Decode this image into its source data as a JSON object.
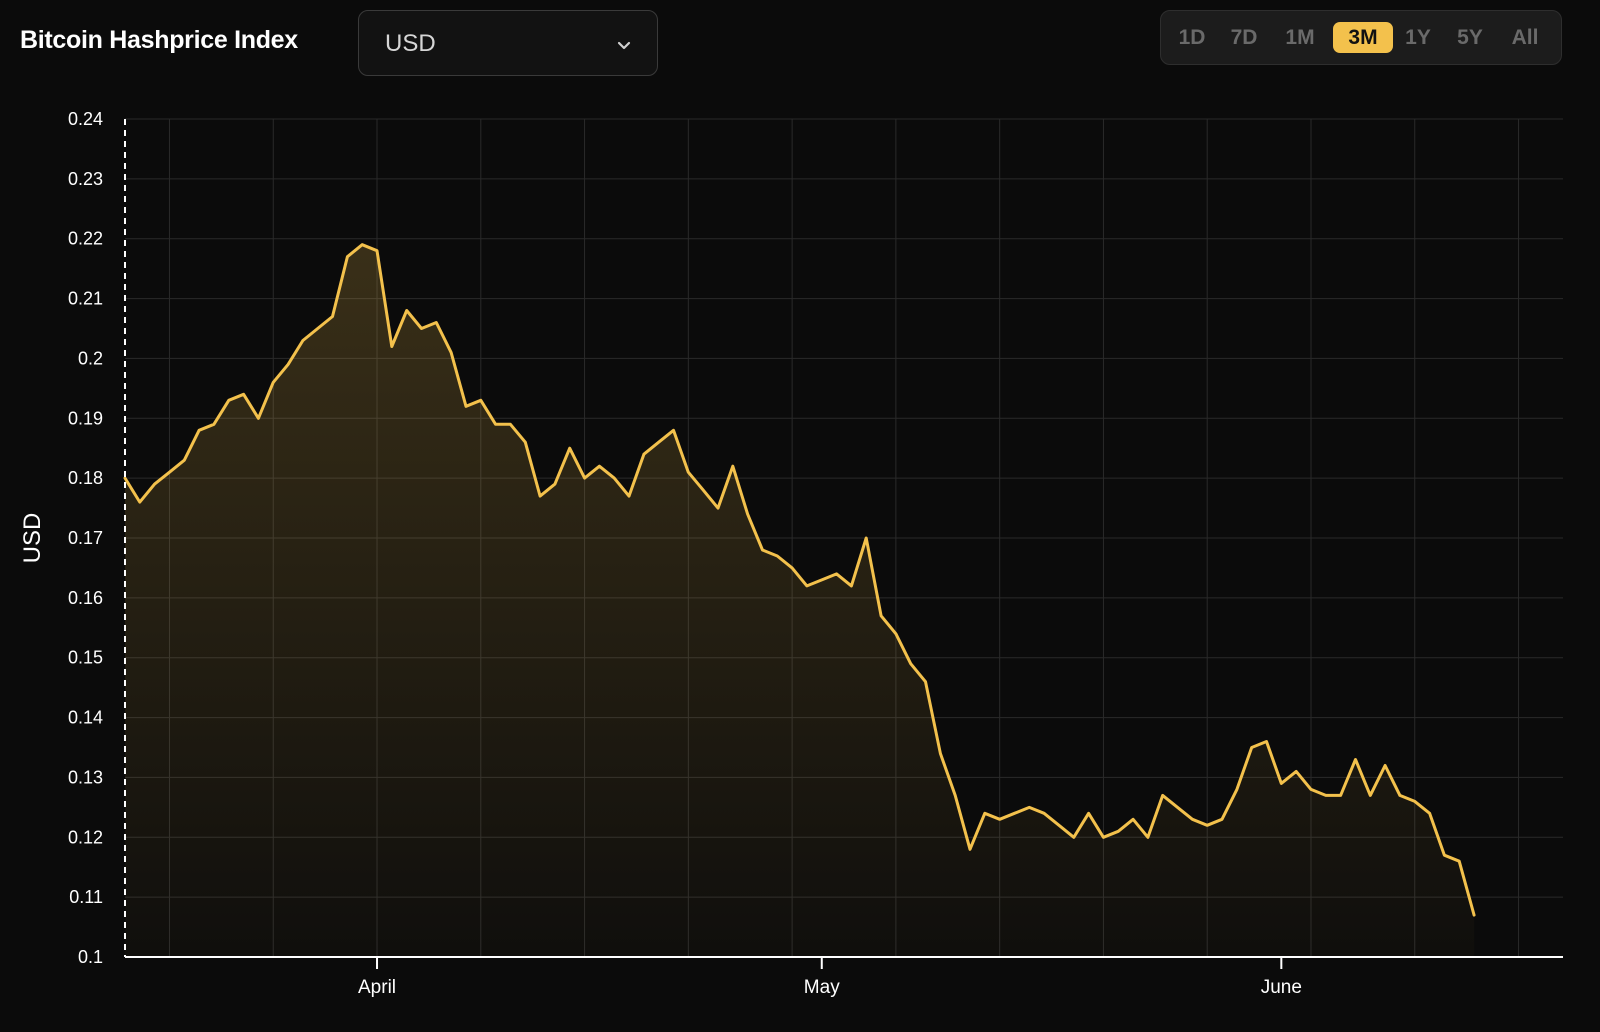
{
  "header": {
    "title": "Bitcoin Hashprice Index",
    "currency": "USD",
    "ranges": [
      "1D",
      "7D",
      "1M",
      "3M",
      "1Y",
      "5Y",
      "All"
    ],
    "active_range": "3M"
  },
  "colors": {
    "background": "#0b0b0b",
    "line": "#f3c14c",
    "grid": "#2a2a2a",
    "active_range_bg": "#f3c14c"
  },
  "chart_data": {
    "type": "area",
    "ylabel": "USD",
    "ylim": [
      0.1,
      0.24
    ],
    "yticks": [
      "0.24",
      "0.23",
      "0.22",
      "0.21",
      "0.2",
      "0.19",
      "0.18",
      "0.17",
      "0.16",
      "0.15",
      "0.14",
      "0.13",
      "0.12",
      "0.11",
      "0.1"
    ],
    "xlim": [
      "2024-03-15",
      "2024-06-20"
    ],
    "xticks": [
      {
        "label": "April",
        "date": "2024-04-01"
      },
      {
        "label": "May",
        "date": "2024-05-01"
      },
      {
        "label": "June",
        "date": "2024-06-01"
      }
    ],
    "grid": true,
    "series": [
      {
        "values": [
          [
            "2024-03-15",
            0.18
          ],
          [
            "2024-03-16",
            0.176
          ],
          [
            "2024-03-17",
            0.179
          ],
          [
            "2024-03-18",
            0.181
          ],
          [
            "2024-03-19",
            0.183
          ],
          [
            "2024-03-20",
            0.188
          ],
          [
            "2024-03-21",
            0.189
          ],
          [
            "2024-03-22",
            0.193
          ],
          [
            "2024-03-23",
            0.194
          ],
          [
            "2024-03-24",
            0.19
          ],
          [
            "2024-03-25",
            0.196
          ],
          [
            "2024-03-26",
            0.199
          ],
          [
            "2024-03-27",
            0.203
          ],
          [
            "2024-03-28",
            0.205
          ],
          [
            "2024-03-29",
            0.207
          ],
          [
            "2024-03-30",
            0.217
          ],
          [
            "2024-03-31",
            0.219
          ],
          [
            "2024-04-01",
            0.218
          ],
          [
            "2024-04-02",
            0.202
          ],
          [
            "2024-04-03",
            0.208
          ],
          [
            "2024-04-04",
            0.205
          ],
          [
            "2024-04-05",
            0.206
          ],
          [
            "2024-04-06",
            0.201
          ],
          [
            "2024-04-07",
            0.192
          ],
          [
            "2024-04-08",
            0.193
          ],
          [
            "2024-04-09",
            0.189
          ],
          [
            "2024-04-10",
            0.189
          ],
          [
            "2024-04-11",
            0.186
          ],
          [
            "2024-04-12",
            0.177
          ],
          [
            "2024-04-13",
            0.179
          ],
          [
            "2024-04-14",
            0.185
          ],
          [
            "2024-04-15",
            0.18
          ],
          [
            "2024-04-16",
            0.182
          ],
          [
            "2024-04-17",
            0.18
          ],
          [
            "2024-04-18",
            0.177
          ],
          [
            "2024-04-19",
            0.184
          ],
          [
            "2024-04-20",
            0.186
          ],
          [
            "2024-04-21",
            0.188
          ],
          [
            "2024-04-22",
            0.181
          ],
          [
            "2024-04-23",
            0.178
          ],
          [
            "2024-04-24",
            0.175
          ],
          [
            "2024-04-25",
            0.182
          ],
          [
            "2024-04-26",
            0.174
          ],
          [
            "2024-04-27",
            0.168
          ],
          [
            "2024-04-28",
            0.167
          ],
          [
            "2024-04-29",
            0.165
          ],
          [
            "2024-04-30",
            0.162
          ],
          [
            "2024-05-01",
            0.163
          ],
          [
            "2024-05-02",
            0.164
          ],
          [
            "2024-05-03",
            0.162
          ],
          [
            "2024-05-04",
            0.17
          ],
          [
            "2024-05-05",
            0.157
          ],
          [
            "2024-05-06",
            0.154
          ],
          [
            "2024-05-07",
            0.149
          ],
          [
            "2024-05-08",
            0.146
          ],
          [
            "2024-05-09",
            0.134
          ],
          [
            "2024-05-10",
            0.127
          ],
          [
            "2024-05-11",
            0.118
          ],
          [
            "2024-05-12",
            0.124
          ],
          [
            "2024-05-13",
            0.123
          ],
          [
            "2024-05-14",
            0.124
          ],
          [
            "2024-05-15",
            0.125
          ],
          [
            "2024-05-16",
            0.124
          ],
          [
            "2024-05-17",
            0.122
          ],
          [
            "2024-05-18",
            0.12
          ],
          [
            "2024-05-19",
            0.124
          ],
          [
            "2024-05-20",
            0.12
          ],
          [
            "2024-05-21",
            0.121
          ],
          [
            "2024-05-22",
            0.123
          ],
          [
            "2024-05-23",
            0.12
          ],
          [
            "2024-05-24",
            0.127
          ],
          [
            "2024-05-25",
            0.125
          ],
          [
            "2024-05-26",
            0.123
          ],
          [
            "2024-05-27",
            0.122
          ],
          [
            "2024-05-28",
            0.123
          ],
          [
            "2024-05-29",
            0.128
          ],
          [
            "2024-05-30",
            0.135
          ],
          [
            "2024-05-31",
            0.136
          ],
          [
            "2024-06-01",
            0.129
          ],
          [
            "2024-06-02",
            0.131
          ],
          [
            "2024-06-03",
            0.128
          ],
          [
            "2024-06-04",
            0.127
          ],
          [
            "2024-06-05",
            0.127
          ],
          [
            "2024-06-06",
            0.133
          ],
          [
            "2024-06-07",
            0.127
          ],
          [
            "2024-06-08",
            0.132
          ],
          [
            "2024-06-09",
            0.127
          ],
          [
            "2024-06-10",
            0.126
          ],
          [
            "2024-06-11",
            0.124
          ],
          [
            "2024-06-12",
            0.117
          ],
          [
            "2024-06-13",
            0.116
          ],
          [
            "2024-06-14",
            0.107
          ]
        ]
      }
    ]
  }
}
